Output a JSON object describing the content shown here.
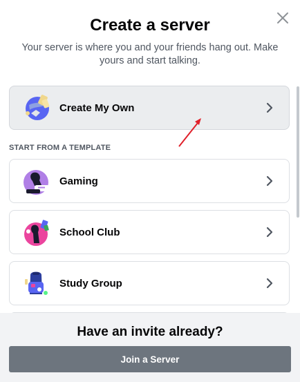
{
  "modal": {
    "title": "Create a server",
    "subtitle": "Your server is where you and your friends hang out. Make yours and start talking.",
    "close_icon": "close-icon"
  },
  "primary_option": {
    "label": "Create My Own",
    "icon": "globe-create-icon"
  },
  "template_section_label": "START FROM A TEMPLATE",
  "templates": [
    {
      "label": "Gaming",
      "icon": "gaming-icon"
    },
    {
      "label": "School Club",
      "icon": "school-club-icon"
    },
    {
      "label": "Study Group",
      "icon": "study-group-icon"
    }
  ],
  "footer": {
    "heading": "Have an invite already?",
    "join_button_label": "Join a Server"
  },
  "colors": {
    "annotation_arrow": "#e0202a",
    "join_button": "#6d757e",
    "footer_bg": "#f2f3f5"
  }
}
